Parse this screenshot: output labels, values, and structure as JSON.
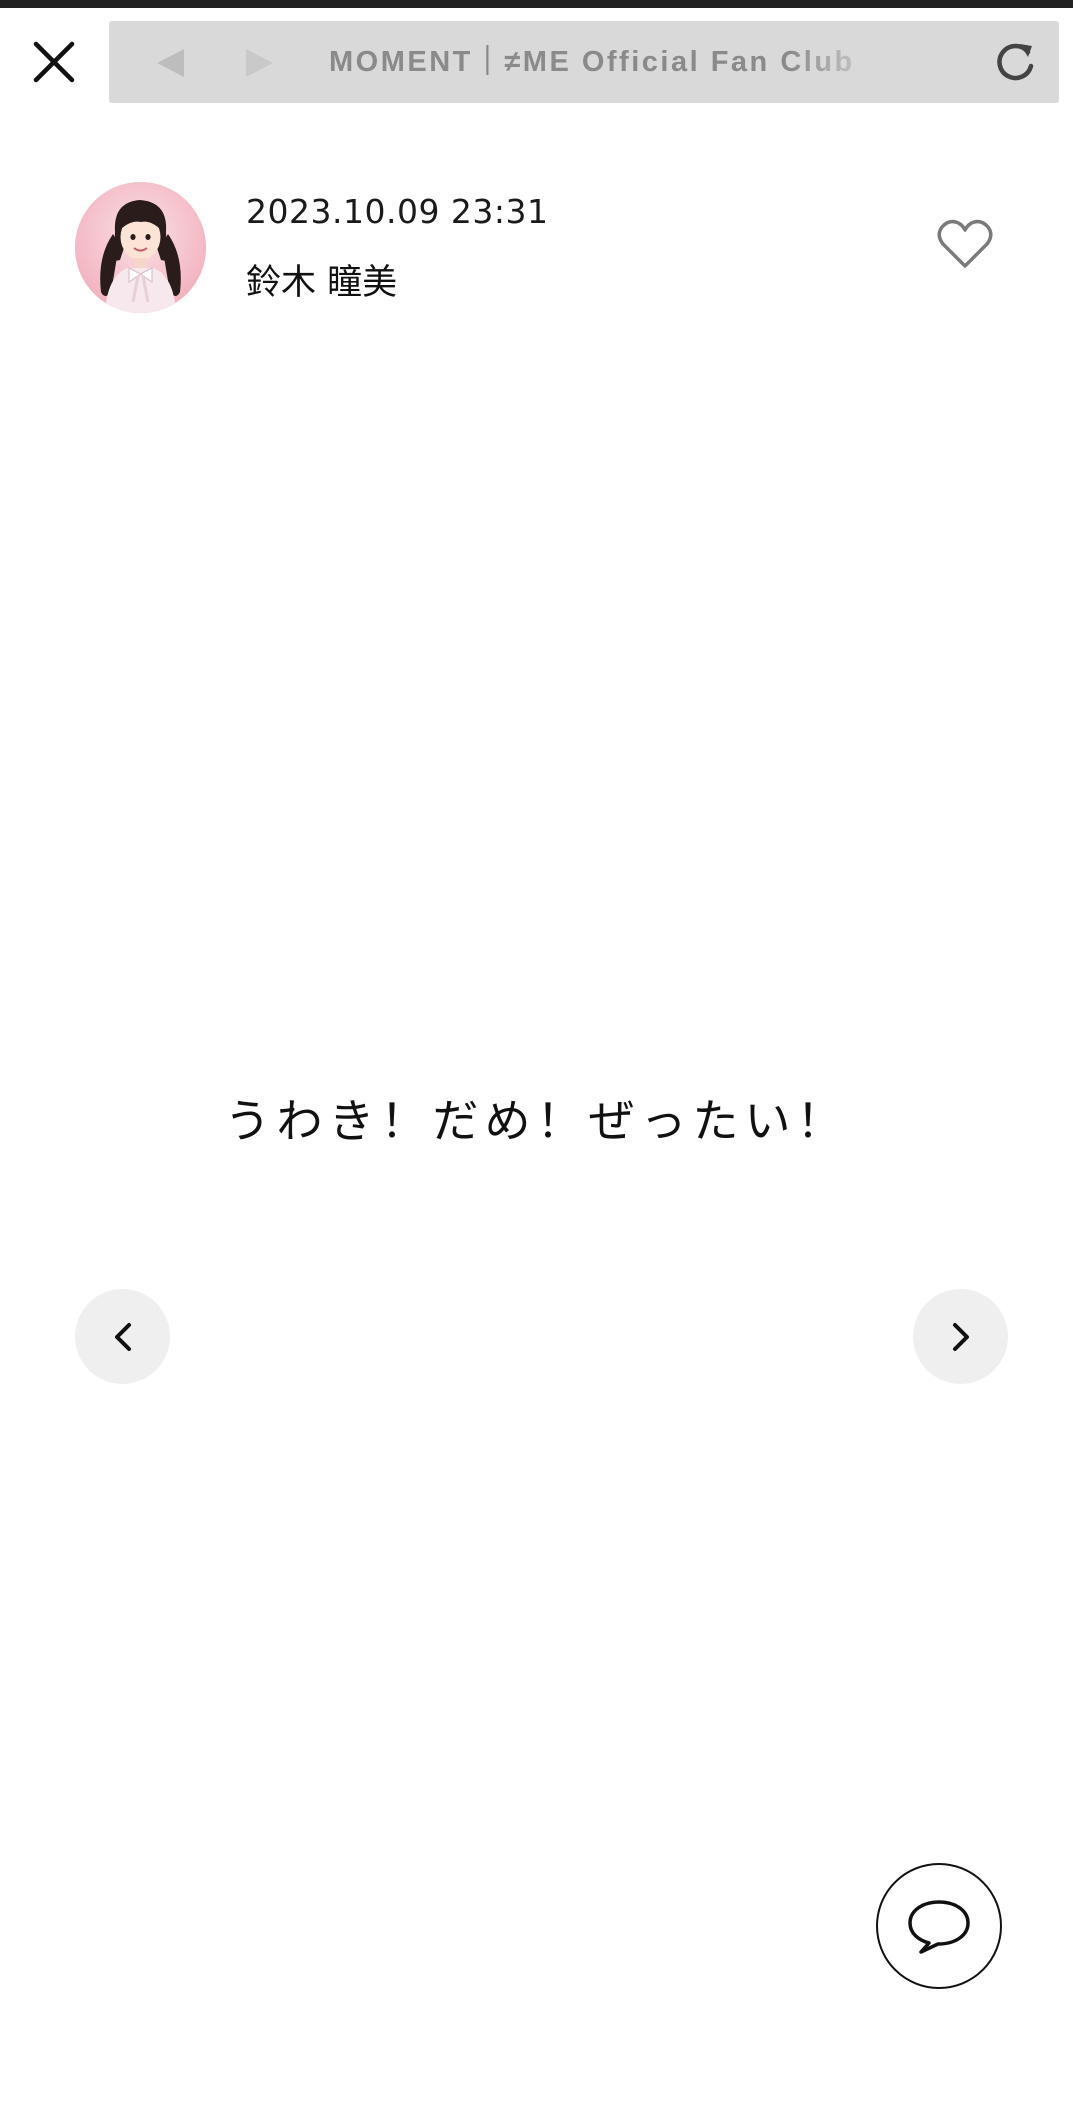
{
  "browser": {
    "page_title": "MOMENT｜≠ME Official Fan Club",
    "back_icon": "back-arrow-icon",
    "forward_icon": "forward-arrow-icon",
    "reload_icon": "reload-icon",
    "bar_color": "#d9d9d9"
  },
  "toolbar": {
    "close_icon": "close-icon"
  },
  "post": {
    "date": "2023.10.09 23:31",
    "author": "鈴木 瞳美",
    "avatar_icon": "avatar",
    "like_icon": "heart-icon",
    "message": "うわき！だめ！ぜったい！"
  },
  "navigation": {
    "prev_icon": "chevron-left-icon",
    "next_icon": "chevron-right-icon"
  },
  "comment": {
    "icon": "speech-bubble-icon"
  },
  "colors": {
    "background": "#ffffff",
    "text": "#111111",
    "nav_circle": "#efefef",
    "heart": "#7a7a7a"
  }
}
